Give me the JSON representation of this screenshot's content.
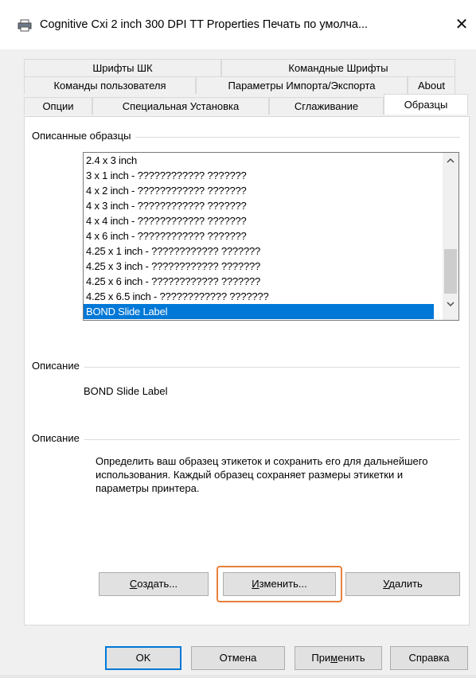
{
  "window": {
    "title": "Cognitive Cxi 2 inch 300 DPI TT Properties Печать по умолча...",
    "close_glyph": "✕",
    "icon": "printer-icon"
  },
  "tabs": {
    "row1": [
      "Шрифты ШК",
      "Командные Шрифты"
    ],
    "row2": [
      "Команды пользователя",
      "Параметры Импорта/Экспорта",
      "About"
    ],
    "row3": [
      "Опции",
      "Специальная Установка",
      "Сглаживание",
      "Образцы"
    ],
    "active": "Образцы"
  },
  "described_samples": {
    "group_label": "Описанные образцы",
    "items": [
      "2.4 x 3 inch",
      "3 x 1 inch - ???????????? ???????",
      "4 x 2 inch - ???????????? ???????",
      "4 x 3 inch - ???????????? ???????",
      "4 x 4 inch - ???????????? ???????",
      "4 x 6 inch - ???????????? ???????",
      "4.25 x 1 inch - ???????????? ???????",
      "4.25 x 3 inch - ???????????? ???????",
      "4.25 x 6 inch - ???????????? ???????",
      "4.25 x 6.5 inch - ???????????? ???????",
      "BOND Slide Label"
    ],
    "selected": "BOND Slide Label"
  },
  "description1": {
    "group_label": "Описание",
    "value": "BOND Slide Label"
  },
  "description2": {
    "group_label": "Описание",
    "text": "Определить ваш образец этикеток и сохранить его для дальнейшего использования. Каждый образец сохраняет размеры этикетки и параметры принтера."
  },
  "actions": {
    "create_u": "С",
    "create_rest": "оздать...",
    "edit_u": "И",
    "edit_rest": "зменить...",
    "delete_u": "У",
    "delete_rest": "далить"
  },
  "footer": {
    "ok": "OK",
    "cancel": "Отмена",
    "apply_pre": "При",
    "apply_u": "м",
    "apply_post": "енить",
    "help": "Справка"
  },
  "colors": {
    "selection": "#0078d7",
    "focus_highlight": "#e8803a"
  }
}
